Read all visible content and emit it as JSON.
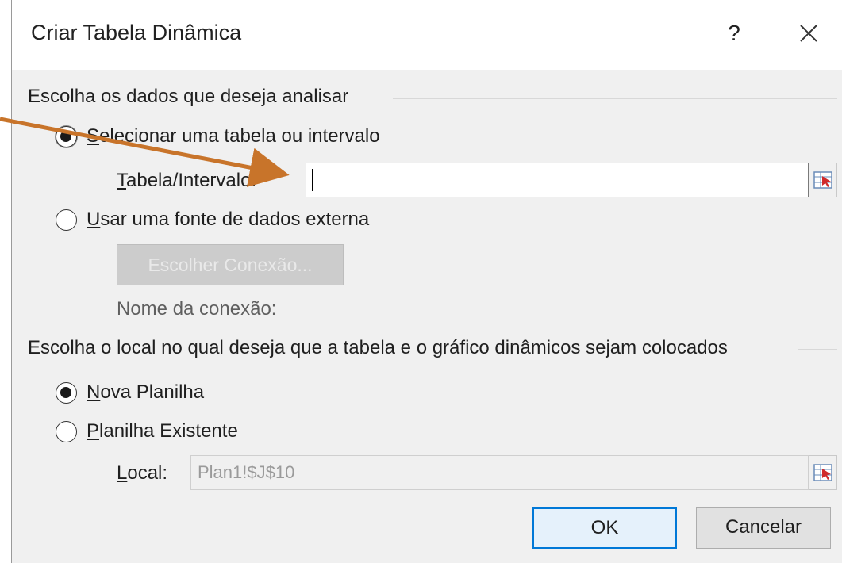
{
  "dialog": {
    "title": "Criar Tabela Dinâmica",
    "help_label": "?"
  },
  "data_section": {
    "label": "Escolha os dados que deseja analisar",
    "option_table": {
      "underlined": "S",
      "rest": "elecionar uma tabela ou intervalo",
      "checked": true
    },
    "table_range_label": {
      "underlined": "T",
      "rest": "abela/Intervalo:"
    },
    "table_range_value": "",
    "option_external": {
      "underlined": "U",
      "rest": "sar uma fonte de dados externa",
      "checked": false
    },
    "choose_connection_label": "Escolher Conexão...",
    "connection_name_label": "Nome da conexão:"
  },
  "location_section": {
    "label": "Escolha o local no qual deseja que a tabela e o gráfico dinâmicos sejam colocados",
    "option_new": {
      "underlined": "N",
      "rest": "ova Planilha",
      "checked": true
    },
    "option_existing": {
      "underlined": "P",
      "rest": "lanilha Existente",
      "checked": false
    },
    "location_label": {
      "underlined": "L",
      "rest": "ocal:"
    },
    "location_value": "Plan1!$J$10"
  },
  "buttons": {
    "ok": "OK",
    "cancel": "Cancelar"
  },
  "colors": {
    "accent": "#0078d7",
    "annotation_arrow": "#c8742a"
  },
  "icons": {
    "close": "close-icon",
    "range_selector": "range-selector-icon"
  }
}
